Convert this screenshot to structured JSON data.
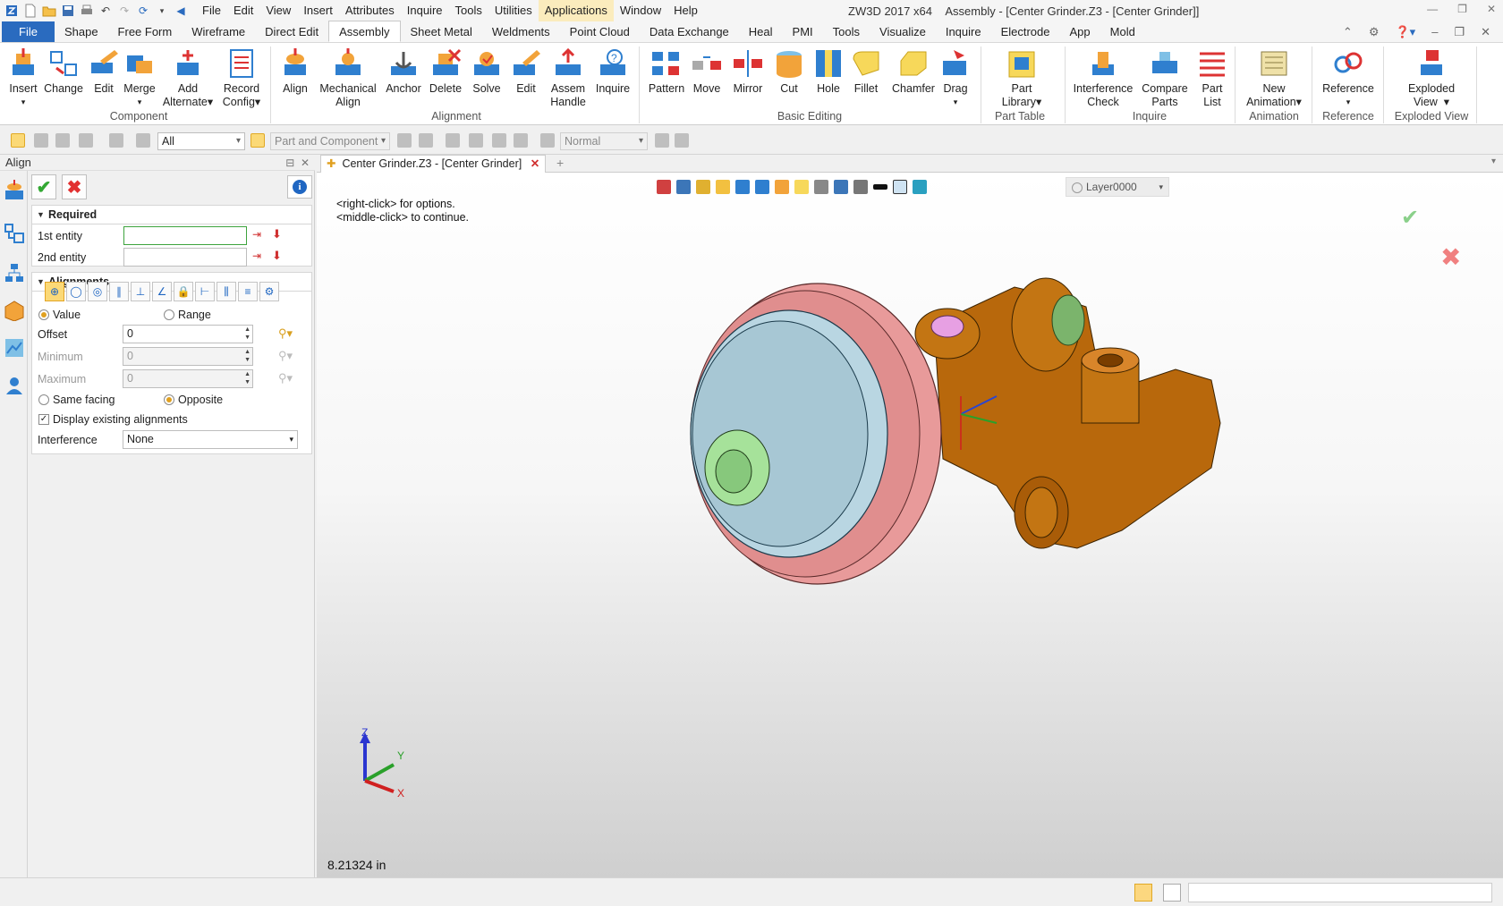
{
  "app_title": "ZW3D 2017 x64",
  "window_title": "Assembly - [Center Grinder.Z3 - [Center Grinder]]",
  "menu": [
    "File",
    "Edit",
    "View",
    "Insert",
    "Attributes",
    "Inquire",
    "Tools",
    "Utilities",
    "Applications",
    "Window",
    "Help"
  ],
  "ribbon_tabs": [
    "File",
    "Shape",
    "Free Form",
    "Wireframe",
    "Direct Edit",
    "Assembly",
    "Sheet Metal",
    "Weldments",
    "Point Cloud",
    "Data Exchange",
    "Heal",
    "PMI",
    "Tools",
    "Visualize",
    "Inquire",
    "Electrode",
    "App",
    "Mold"
  ],
  "ribbon": {
    "component": {
      "group": "Component",
      "insert": "Insert",
      "change": "Change",
      "edit": "Edit",
      "merge": "Merge",
      "add_alternate_1": "Add",
      "add_alternate_2": "Alternate",
      "record_config_1": "Record",
      "record_config_2": "Config"
    },
    "alignment": {
      "group": "Alignment",
      "align": "Align",
      "mech_align_1": "Mechanical",
      "mech_align_2": "Align",
      "anchor": "Anchor",
      "delete": "Delete",
      "solve": "Solve",
      "edit": "Edit",
      "assem_handle_1": "Assem",
      "assem_handle_2": "Handle",
      "inquire": "Inquire"
    },
    "basic_editing": {
      "group": "Basic Editing",
      "pattern": "Pattern",
      "move": "Move",
      "mirror": "Mirror",
      "cut": "Cut",
      "hole": "Hole",
      "fillet": "Fillet",
      "chamfer": "Chamfer",
      "drag": "Drag"
    },
    "part_table": {
      "group": "Part Table",
      "part_library_1": "Part",
      "part_library_2": "Library"
    },
    "inquire": {
      "group": "Inquire",
      "interference_1": "Interference",
      "interference_2": "Check",
      "compare_1": "Compare",
      "compare_2": "Parts",
      "part_list_1": "Part",
      "part_list_2": "List"
    },
    "animation": {
      "group": "Animation",
      "new_anim_1": "New",
      "new_anim_2": "Animation"
    },
    "reference": {
      "group": "Reference",
      "reference": "Reference"
    },
    "exploded": {
      "group": "Exploded View",
      "exploded_1": "Exploded",
      "exploded_2": "View"
    }
  },
  "toolbar": {
    "filter": "All",
    "pick_mode": "Part and Component",
    "display_mode": "Normal"
  },
  "panel": {
    "title": "Align",
    "required": "Required",
    "first_entity": "1st entity",
    "second_entity": "2nd entity",
    "alignments": "Alignments",
    "value": "Value",
    "range": "Range",
    "offset_label": "Offset",
    "offset_value": "0",
    "minimum_label": "Minimum",
    "minimum_value": "0",
    "maximum_label": "Maximum",
    "maximum_value": "0",
    "same_facing": "Same facing",
    "opposite": "Opposite",
    "display_existing": "Display existing alignments",
    "interference_label": "Interference",
    "interference_value": "None"
  },
  "doc_tab": "Center Grinder.Z3 - [Center Grinder]",
  "viewport": {
    "hint1": "<right-click> for options.",
    "hint2": "<middle-click> to continue.",
    "layer": "Layer0000",
    "scale": "8.21324 in",
    "axis_x": "X",
    "axis_y": "Y",
    "axis_z": "Z"
  },
  "colors": {
    "accent": "#2a6bbf",
    "wheel": "#e89a9a",
    "disc": "#b9d6e2",
    "body": "#b8680c",
    "hub": "#a6e29a"
  }
}
